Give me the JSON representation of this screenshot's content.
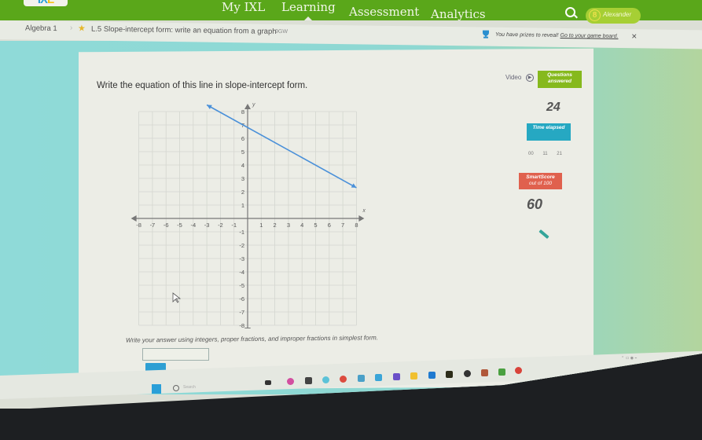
{
  "app": {
    "logo": {
      "part1": "IX",
      "part2": "L"
    },
    "nav": {
      "items": [
        {
          "label": "My IXL",
          "active": false
        },
        {
          "label": "Learning",
          "active": true
        },
        {
          "label": "Assessment",
          "active": false
        },
        {
          "label": "Analytics",
          "active": false
        }
      ],
      "user_initial": "8",
      "user_name": "Alexander"
    },
    "breadcrumb": {
      "subject": "Algebra 1",
      "separator": "›",
      "skill": "L.5 Slope-intercept form: write an equation from a graph",
      "skill_code": "9GW"
    },
    "prize_banner": {
      "text": "You have prizes to reveal!",
      "link": "Go to your game board.",
      "close": "✕"
    }
  },
  "question": {
    "prompt": "Write the equation of this line in slope-intercept form.",
    "instructions": "Write your answer using integers, proper fractions, and improper fractions in simplest form.",
    "answer_value": "",
    "submit_label": ""
  },
  "sidebar": {
    "video_label": "Video",
    "video_icon": "▶",
    "questions_answered_label": "Questions answered",
    "questions_answered": "24",
    "time_elapsed_label": "Time elapsed",
    "time": {
      "hr": "00",
      "min": "11",
      "sec": "21"
    },
    "smartscore_label": "SmartScore",
    "smartscore_sub": "out of 100",
    "smartscore": "60"
  },
  "chart_data": {
    "type": "line",
    "title": "",
    "xlabel": "x",
    "ylabel": "y",
    "xlim": [
      -8,
      8
    ],
    "ylim": [
      -8,
      8
    ],
    "x_ticks": [
      -8,
      -7,
      -6,
      -5,
      -4,
      -3,
      -2,
      -1,
      1,
      2,
      3,
      4,
      5,
      6,
      7,
      8
    ],
    "y_ticks": [
      -8,
      -7,
      -6,
      -5,
      -4,
      -3,
      -2,
      -1,
      1,
      2,
      3,
      4,
      5,
      6,
      7,
      8
    ],
    "grid": true,
    "series": [
      {
        "name": "line",
        "color": "#4a90d9",
        "points": [
          [
            -3,
            8.5
          ],
          [
            0,
            7
          ],
          [
            8,
            2.3
          ]
        ]
      }
    ]
  },
  "taskbar": {
    "search_placeholder": "Search"
  },
  "colors": {
    "nav_green": "#5aa71a",
    "questions_badge": "#86b91d",
    "time_badge": "#26a8c2",
    "score_badge": "#e0614e",
    "submit_blue": "#2e9fd3"
  }
}
